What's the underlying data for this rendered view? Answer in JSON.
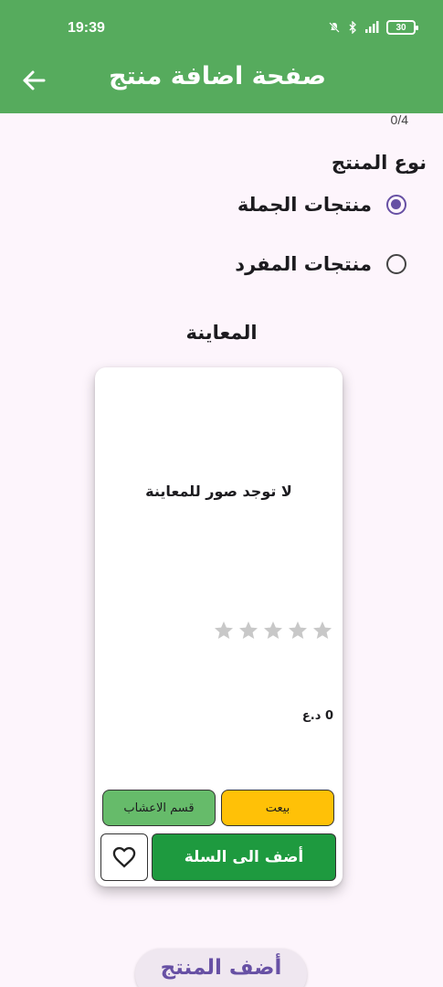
{
  "status_bar": {
    "time": "19:39",
    "battery": "30",
    "icons": [
      "mute-icon",
      "bluetooth-icon",
      "signal-icon",
      "battery-icon"
    ]
  },
  "app_bar": {
    "title": "صفحة اضافة منتج",
    "back_icon": "arrow-back-icon",
    "background_color": "#56ab5d"
  },
  "image_counter": "0/4",
  "product_type": {
    "label": "نوع المنتج",
    "options": [
      {
        "label": "منتجات الجملة",
        "selected": true
      },
      {
        "label": "منتجات المفرد",
        "selected": false
      }
    ]
  },
  "preview": {
    "label": "المعاينة",
    "card": {
      "no_images_text": "لا توجد صور للمعاينة",
      "rating": 0,
      "rating_max": 5,
      "price": "0 د.ع",
      "sold_chip": "بيعت",
      "category_chip": "قسم الاعشاب",
      "add_to_cart": "أضف الى السلة",
      "favorite_icon": "heart-outline-icon"
    }
  },
  "submit_button": "أضف المنتج",
  "colors": {
    "primary": "#6750a4",
    "add_to_cart": "#1e9a3f",
    "sold_chip": "#ffc107",
    "category_chip": "#66bb6a",
    "star_empty": "#c8c8c8"
  }
}
